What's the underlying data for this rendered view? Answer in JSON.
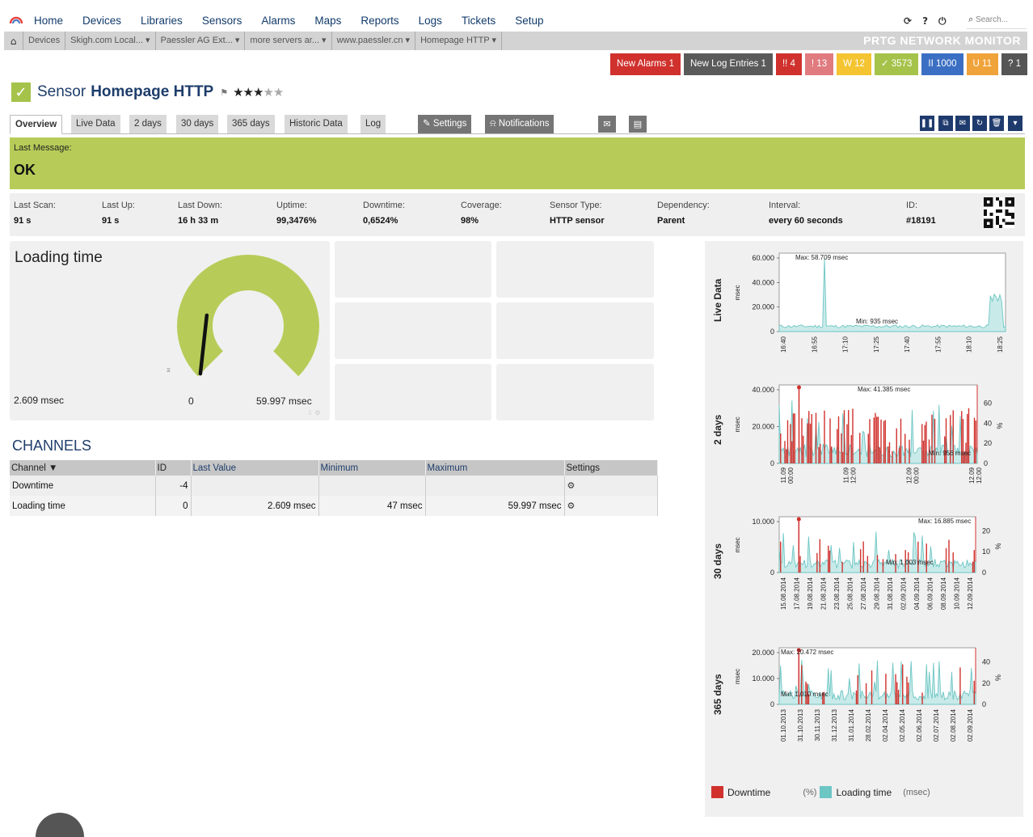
{
  "nav": {
    "menu": [
      "Home",
      "Devices",
      "Libraries",
      "Sensors",
      "Alarms",
      "Maps",
      "Reports",
      "Logs",
      "Tickets",
      "Setup"
    ],
    "tools": [
      "⟳",
      "?",
      "⏻"
    ],
    "search_placeholder": "Search..."
  },
  "breadcrumb": {
    "items": [
      "Devices",
      "Skigh.com Local... ▾",
      "Paessler AG Ext... ▾",
      "more servers ar... ▾",
      "www.paessler.cn ▾",
      "Homepage HTTP ▾"
    ],
    "brand": "PRTG NETWORK MONITOR"
  },
  "alarms": [
    {
      "label": "New Alarms  1",
      "color": "#d0312d"
    },
    {
      "label": "New Log Entries  1",
      "color": "#5a5a5a"
    },
    {
      "label": "!! 4",
      "color": "#d0312d"
    },
    {
      "label": "! 13",
      "color": "#e07b80"
    },
    {
      "label": "W 12",
      "color": "#f4c431"
    },
    {
      "label": "✓ 3573",
      "color": "#a5c34a"
    },
    {
      "label": "II 1000",
      "color": "#3b6fc3"
    },
    {
      "label": "U 11",
      "color": "#f0a33a"
    },
    {
      "label": "? 1",
      "color": "#555555"
    }
  ],
  "title": {
    "prefix": "Sensor",
    "name": "Homepage HTTP",
    "flag": "⚑",
    "stars_on": "★★★",
    "stars_off": "★★"
  },
  "tabs": {
    "overview": "Overview",
    "live": "Live Data",
    "two_days": "2 days",
    "thirty_days": "30 days",
    "year": "365 days",
    "historic": "Historic Data",
    "log": "Log",
    "settings": "Settings",
    "notifications": "Notifications"
  },
  "last_message": {
    "label": "Last Message:",
    "value": "OK"
  },
  "info": [
    {
      "label": "Last Scan:",
      "value": "91 s"
    },
    {
      "label": "Last Up:",
      "value": "91 s"
    },
    {
      "label": "Last Down:",
      "value": "16 h 33 m"
    },
    {
      "label": "Uptime:",
      "value": "99,3476%"
    },
    {
      "label": "Downtime:",
      "value": "0,6524%"
    },
    {
      "label": "Coverage:",
      "value": "98%"
    },
    {
      "label": "Sensor Type:",
      "value": "HTTP sensor"
    },
    {
      "label": "Dependency:",
      "value": "Parent"
    },
    {
      "label": "Interval:",
      "value": "every 60 seconds"
    },
    {
      "label": "ID:",
      "value": "#18191"
    }
  ],
  "gauge": {
    "title": "Loading time",
    "current": "2.609 msec",
    "min": "0",
    "max": "59.997 msec",
    "value_fraction": 0.22,
    "color": "#b7cc58"
  },
  "channels": {
    "title": "CHANNELS",
    "headers": [
      "Channel ▼",
      "ID",
      "Last Value",
      "Minimum",
      "Maximum",
      "Settings"
    ],
    "rows": [
      {
        "channel": "Downtime",
        "id": "-4",
        "last": "",
        "min": "",
        "max": ""
      },
      {
        "channel": "Loading time",
        "id": "0",
        "last": "2.609 msec",
        "min": "47 msec",
        "max": "59.997 msec"
      }
    ]
  },
  "charts": {
    "labels": [
      "Live Data",
      "2 days",
      "30 days",
      "365 days"
    ],
    "unit_left": "msec",
    "unit_right": "%",
    "live": {
      "max": "Max: 58.709 msec",
      "min": "Min: 935 msec",
      "yticks": [
        "60.000",
        "40.000",
        "20.000",
        "0"
      ],
      "xticks": [
        "16:40",
        "16:55",
        "17:10",
        "17:25",
        "17:40",
        "17:55",
        "18:10",
        "18:25"
      ]
    },
    "d2": {
      "max": "Max: 41.385 msec",
      "min": "Min: 956 msec",
      "yticks": [
        "40.000",
        "20.000",
        "0"
      ],
      "rticks": [
        "60",
        "40",
        "20",
        "0"
      ],
      "xticks": [
        "11.09\n00:00",
        "11.09\n12:00",
        "12.09\n00:00",
        "12.09\n12:00"
      ]
    },
    "d30": {
      "max": "Max: 16.885 msec",
      "min": "Min: 1.003 msec",
      "yticks": [
        "10.000",
        "0"
      ],
      "rticks": [
        "20",
        "10",
        "0"
      ],
      "xticks": [
        "15.08.2014",
        "17.08.2014",
        "19.08.2014",
        "21.08.2014",
        "23.08.2014",
        "25.08.2014",
        "27.08.2014",
        "29.08.2014",
        "31.08.2014",
        "02.09.2014",
        "04.09.2014",
        "06.09.2014",
        "08.09.2014",
        "10.09.2014",
        "12.09.2014"
      ]
    },
    "d365": {
      "max": "Max: 20.472 msec",
      "min": "Min: 1.010 msec",
      "yticks": [
        "20.000",
        "10.000",
        "0"
      ],
      "rticks": [
        "40",
        "20",
        "0"
      ],
      "xticks": [
        "01.10.2013",
        "31.10.2013",
        "30.11.2013",
        "31.12.2013",
        "31.01.2014",
        "28.02.2014",
        "02.04.2014",
        "02.05.2014",
        "02.06.2014",
        "02.07.2014",
        "02.08.2014",
        "02.09.2014"
      ]
    },
    "legend": {
      "downtime": "Downtime",
      "downtime_unit": "(%)",
      "loading": "Loading time",
      "loading_unit": "(msec)",
      "downtime_color": "#d0312d",
      "loading_color": "#6cc6c4"
    }
  }
}
